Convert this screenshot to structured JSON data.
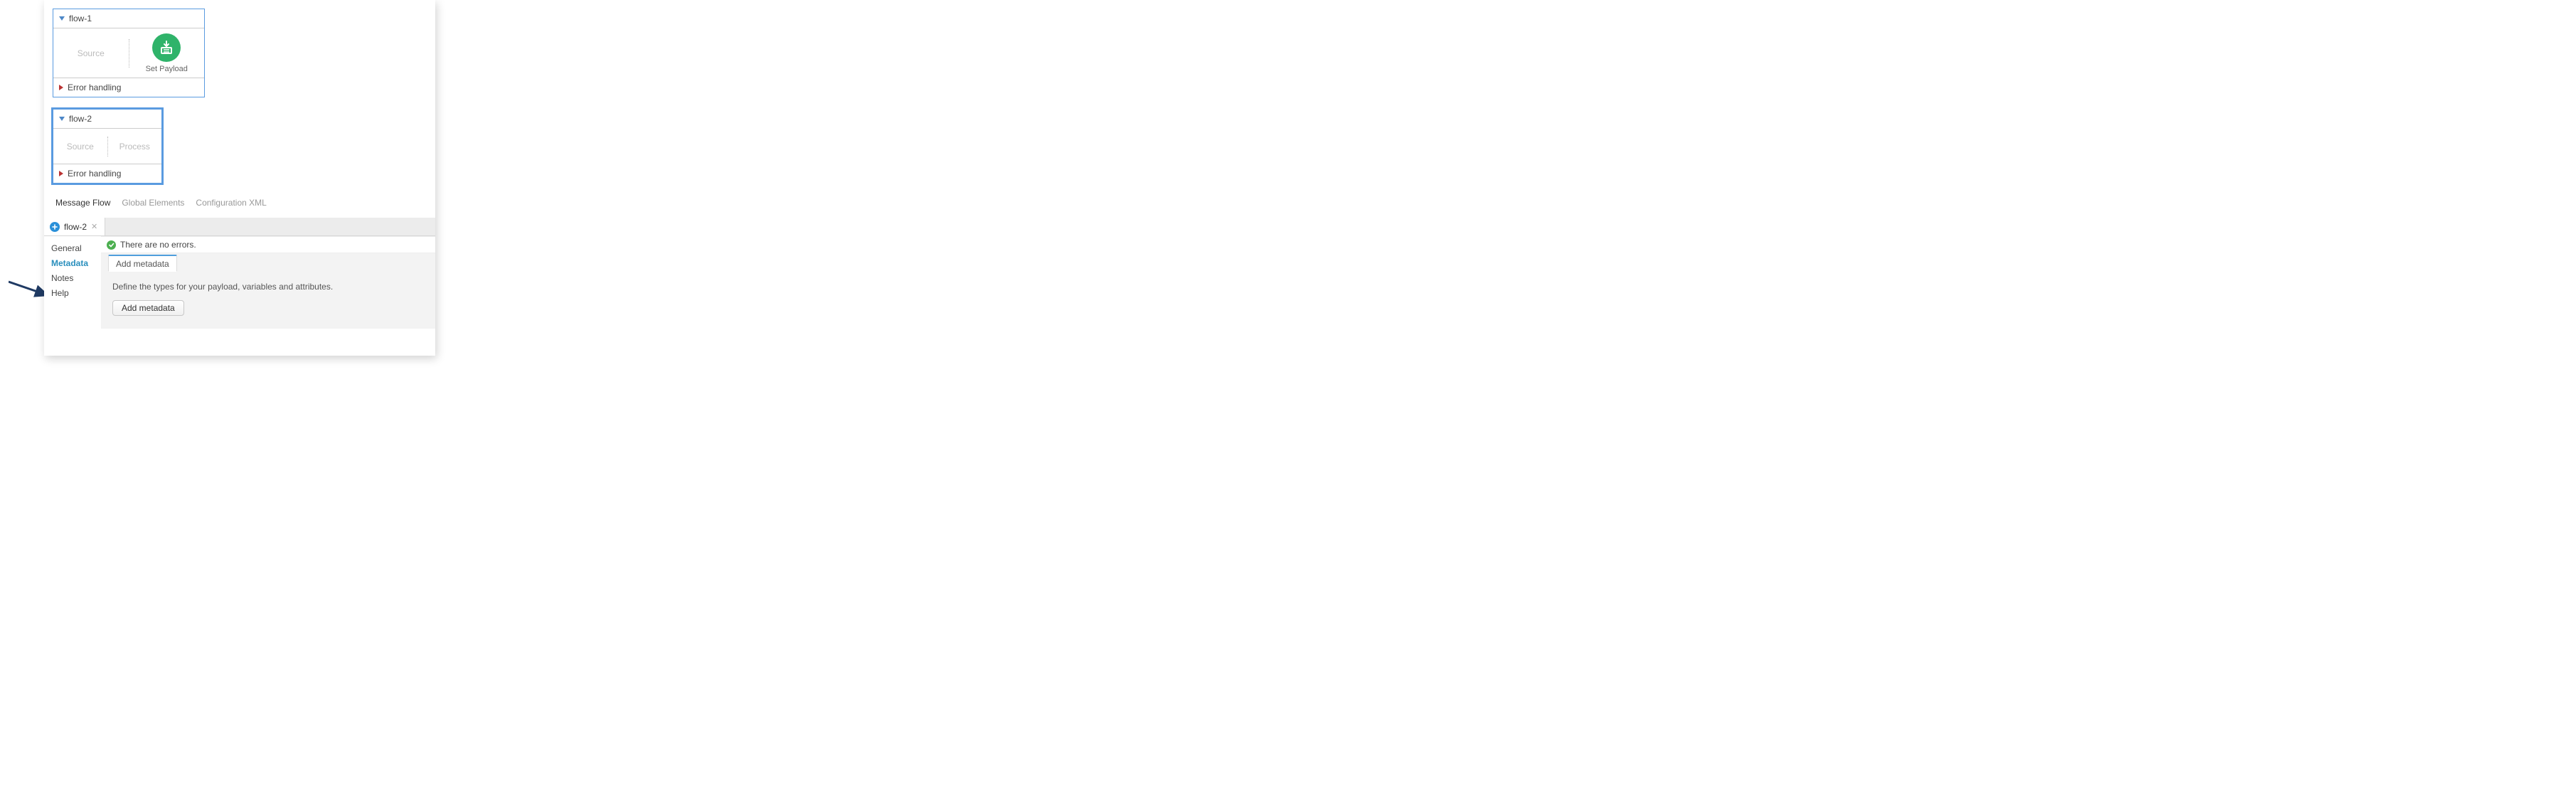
{
  "flows": [
    {
      "name": "flow-1",
      "source_label": "Source",
      "component_label": "Set Payload",
      "error_label": "Error handling"
    },
    {
      "name": "flow-2",
      "source_label": "Source",
      "process_label": "Process",
      "error_label": "Error handling"
    }
  ],
  "canvas_tabs": {
    "message_flow": "Message Flow",
    "global_elements": "Global Elements",
    "configuration_xml": "Configuration XML"
  },
  "editor": {
    "tab_label": "flow-2",
    "status_ok": "There are no errors.",
    "sidebar": {
      "general": "General",
      "metadata": "Metadata",
      "notes": "Notes",
      "help": "Help"
    },
    "inner_tab": "Add metadata",
    "hint": "Define the types for your payload, variables and attributes.",
    "add_btn": "Add metadata"
  }
}
